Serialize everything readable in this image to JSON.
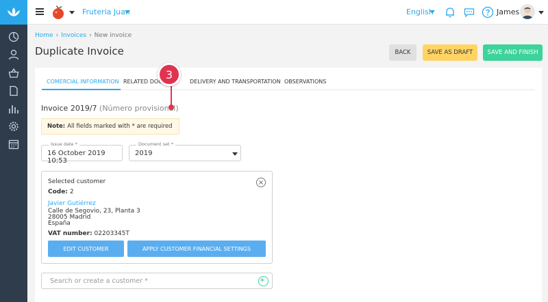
{
  "topbar": {
    "store_name": "Fruteria Juan",
    "language": "English",
    "user_name": "James"
  },
  "breadcrumb": {
    "home": "Home",
    "invoices": "Invoices",
    "current": "New invoice"
  },
  "page_title": "Duplicate Invoice",
  "actions": {
    "back": "BACK",
    "save_draft": "SAVE AS DRAFT",
    "save_finish": "SAVE AND FINISH"
  },
  "tabs": [
    {
      "label": "COMERCIAL INFORMATION",
      "active": true
    },
    {
      "label": "RELATED DOCU"
    },
    {
      "label": "DELIVERY AND TRANSPORTATION"
    },
    {
      "label": "OBSERVATIONS"
    }
  ],
  "step_badge": "3",
  "invoice": {
    "number": "Invoice 2019/7",
    "provisional": "(Número provisional)"
  },
  "note": {
    "label": "Note:",
    "text": "All fields marked with * are required"
  },
  "issue_date": {
    "label": "Issue date *",
    "value": "16 October 2019 10:53"
  },
  "document_set": {
    "label": "Document set *",
    "value": "2019"
  },
  "customer": {
    "heading": "Selected customer",
    "code_label": "Code:",
    "code_value": "2",
    "name": "Javier Gutiérrez",
    "address1": "Calle de Segovio, 23, Planta 3",
    "address2": "28005 Madrid",
    "country": "España",
    "vat_label": "VAT number:",
    "vat_value": "02203345T",
    "edit_button": "EDIT CUSTOMER",
    "apply_button": "APPLY CUSTOMER FINANCIAL SETTINGS"
  },
  "search": {
    "placeholder": "Search or create a customer *"
  },
  "colors": {
    "accent": "#2aa7ea",
    "sidebar": "#2f3c4c",
    "draft": "#ffd465",
    "finish": "#3dd39a",
    "badge": "#e0334f"
  }
}
